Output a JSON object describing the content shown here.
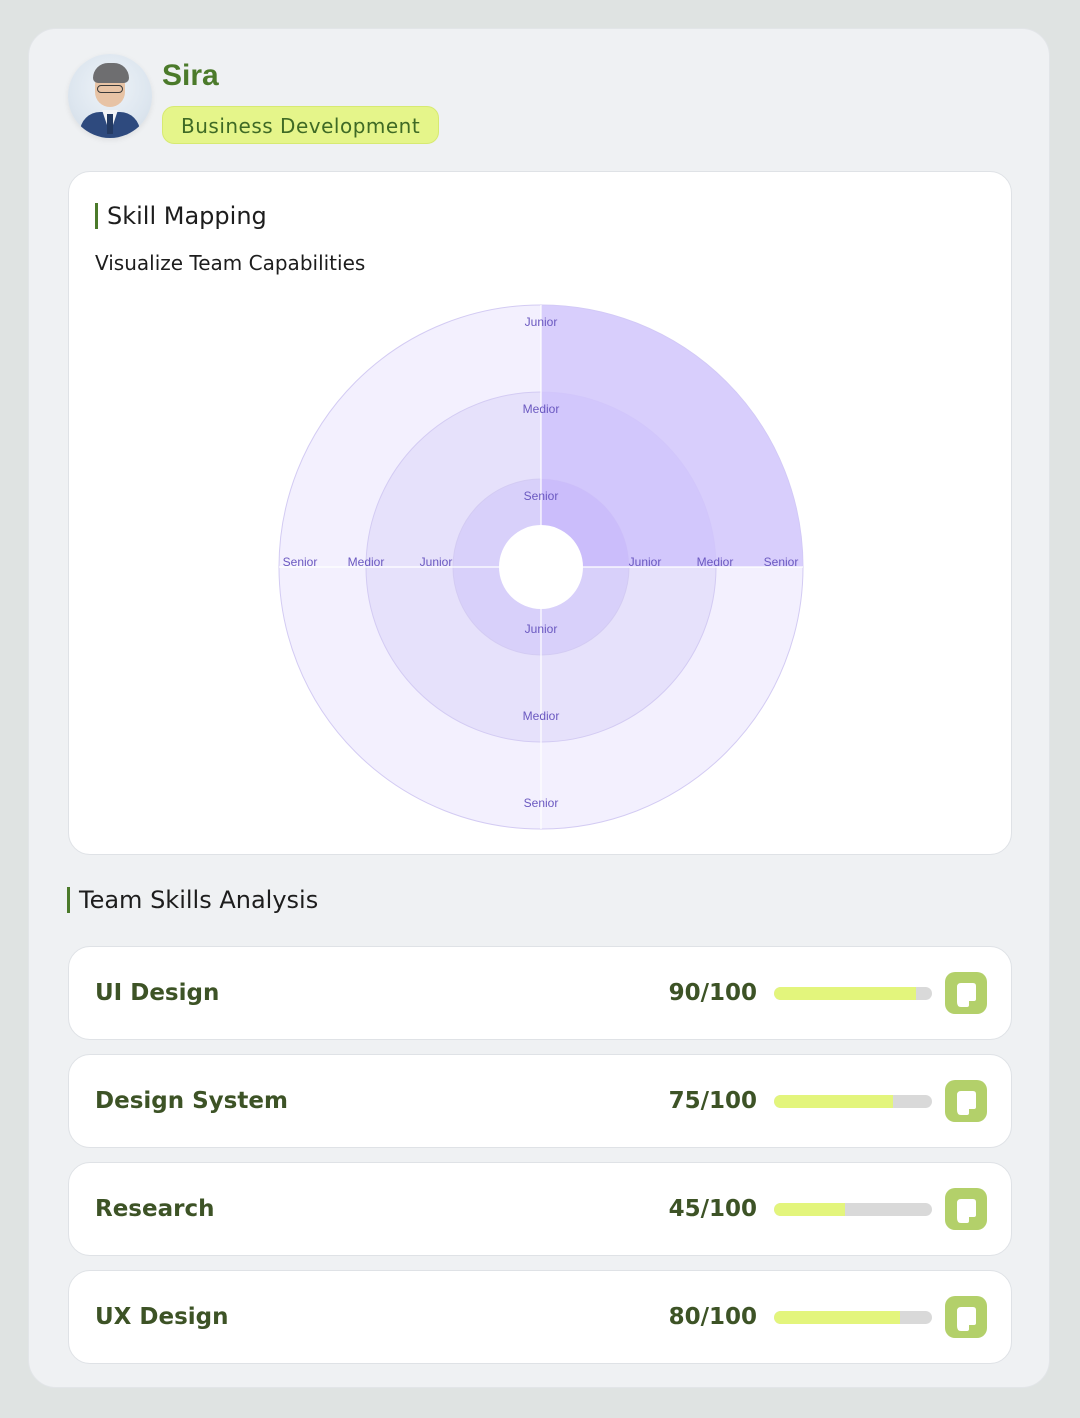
{
  "profile": {
    "name": "Sira",
    "department": "Business Development"
  },
  "skill_mapping": {
    "title": "Skill Mapping",
    "subtitle": "Visualize Team Capabilities"
  },
  "chart_data": {
    "type": "sunburst",
    "rings": [
      "Senior",
      "Medior",
      "Junior"
    ],
    "quadrants": [
      {
        "name": "top",
        "labels": [
          "Junior",
          "Medior",
          "Senior"
        ],
        "highlight": false
      },
      {
        "name": "right",
        "labels": [
          "Junior",
          "Medior",
          "Senior"
        ],
        "highlight": true
      },
      {
        "name": "bottom",
        "labels": [
          "Junior",
          "Medior",
          "Senior"
        ],
        "highlight": false
      },
      {
        "name": "left",
        "labels": [
          "Senior",
          "Medior",
          "Junior"
        ],
        "highlight": false
      }
    ],
    "colors": {
      "light": "#f3f0fe",
      "mid": "#e6e1fb",
      "inner": "#d8d0fa",
      "highlight": "#d2c8fb",
      "label": "#6a58c0",
      "stroke": "#d3cbf3"
    }
  },
  "team_skills": {
    "title": "Team Skills Analysis",
    "items": [
      {
        "name": "UI Design",
        "score_text": "90/100",
        "score": 90
      },
      {
        "name": "Design System",
        "score_text": "75/100",
        "score": 75
      },
      {
        "name": "Research",
        "score_text": "45/100",
        "score": 45
      },
      {
        "name": "UX Design",
        "score_text": "80/100",
        "score": 80
      }
    ],
    "action_icon": "corner-arrow-icon"
  },
  "colors": {
    "accent_green": "#4b7a2a",
    "badge_bg": "#e5f58a",
    "bar_fill": "#e3f57c",
    "icon_bg": "#b3d06a"
  }
}
